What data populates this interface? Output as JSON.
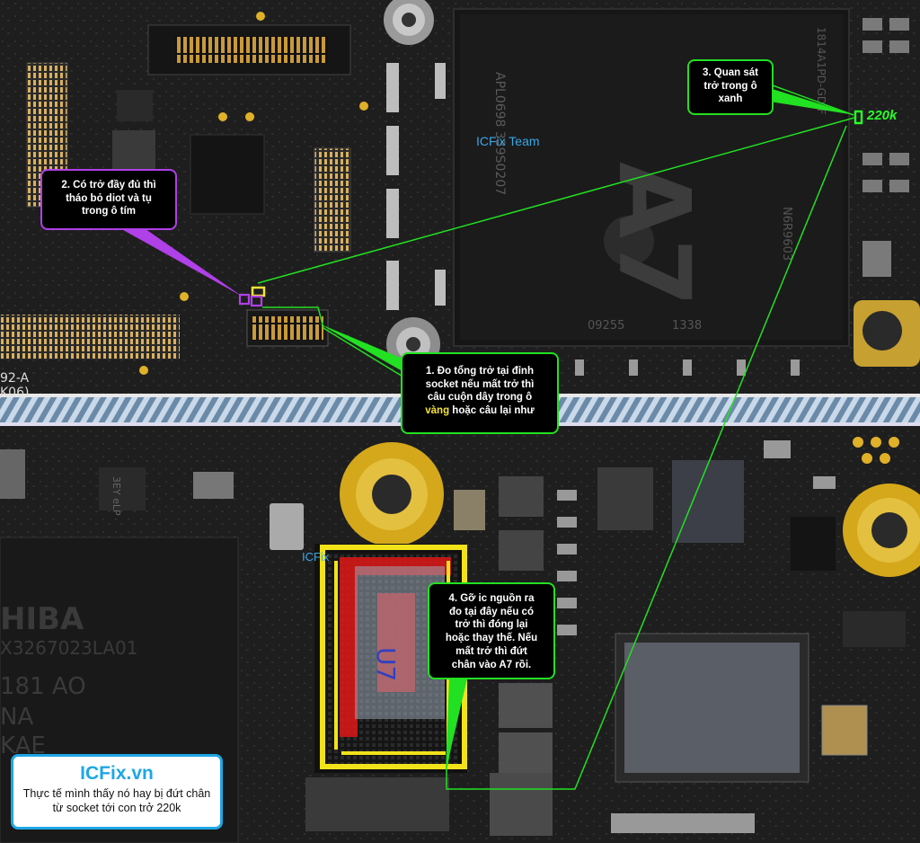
{
  "callouts": {
    "step1": {
      "line1": "1. Đo tổng trở tại đỉnh",
      "line2": "socket nếu mất trở thì",
      "line3": "câu cuộn dây trong ô",
      "line4_highlight": "vàng",
      "line4_rest": " hoặc câu lại như"
    },
    "step2": {
      "line1": "2. Có trở đầy đủ thì",
      "line2": "tháo bỏ diot và tụ",
      "line3": "trong ô tím"
    },
    "step3": {
      "line1": "3. Quan sát",
      "line2": "trở trong ô",
      "line3": "xanh"
    },
    "step4": {
      "line1": "4. Gỡ ic nguồn ra",
      "line2": "đo tại đây nếu có",
      "line3": "trở thì đóng lại",
      "line4": "hoặc thay thế. Nếu",
      "line5": "mất trở thì đứt",
      "line6": "chân vào A7 rồi."
    }
  },
  "labels": {
    "team": "ICFix Team",
    "icfix_small": "ICFix",
    "resistor": "220k",
    "u7": "U7"
  },
  "chips": {
    "a7_line1": "1814A1PD-GD-F",
    "a7_line2": "APL0698  339S0207",
    "a7_big": "A7",
    "a7_code1": "09255",
    "a7_code2": "1338",
    "a7_side": "N6R9603",
    "toshiba_1": "HIBA",
    "toshiba_2": "X3267023LA01",
    "toshiba_3": "181  AO",
    "toshiba_4": "NA",
    "toshiba_5": "KAE",
    "small_chip": "3EY eLP",
    "board_mark1": "92-A",
    "board_mark2": "K06)"
  },
  "brand": {
    "title": "ICFix.vn",
    "desc_line1": "Thực tế mình thấy nó hay bị đứt chân",
    "desc_line2": "từ socket tới con trở 220k"
  },
  "colors": {
    "callout_green": "#22e022",
    "callout_purple": "#b040e8",
    "highlight_yellow": "#f5e33a",
    "brand_blue": "#1ea7e6"
  }
}
